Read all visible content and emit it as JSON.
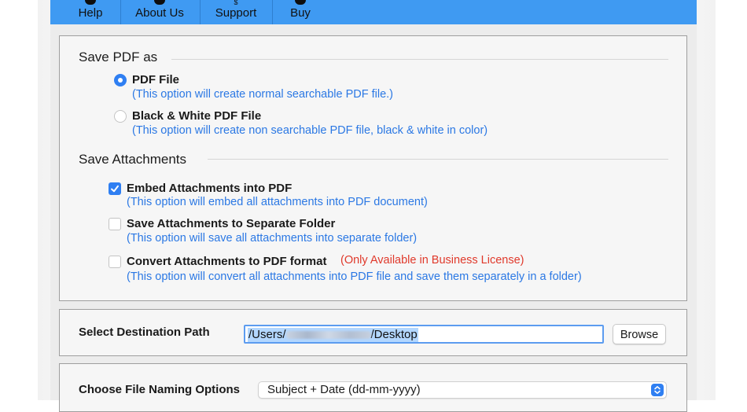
{
  "toolbar": {
    "buttons": [
      {
        "label": "Help",
        "icon": "help-icon"
      },
      {
        "label": "About Us",
        "icon": "info-icon"
      },
      {
        "label": "Support",
        "icon": "dollar-support-icon"
      },
      {
        "label": "Buy",
        "icon": "cart-icon"
      }
    ]
  },
  "save_pdf": {
    "title": "Save PDF as",
    "options": [
      {
        "label": "PDF File",
        "desc": "(This option will create normal searchable PDF file.)",
        "selected": true
      },
      {
        "label": "Black & White PDF File",
        "desc": "(This option will create non searchable PDF file, black & white in color)",
        "selected": false
      }
    ]
  },
  "attachments": {
    "title": "Save Attachments",
    "options": [
      {
        "label": "Embed Attachments into PDF",
        "desc": "(This option will embed all attachments into PDF document)",
        "checked": true
      },
      {
        "label": "Save Attachments to Separate Folder",
        "desc": "(This option will save all attachments into separate folder)",
        "checked": false
      },
      {
        "label": "Convert Attachments to PDF format",
        "warning": "(Only Available in Business License)",
        "desc": "(This option will convert all attachments into PDF file and save them separately in a folder)",
        "checked": false
      }
    ]
  },
  "destination": {
    "label": "Select Destination Path",
    "path_prefix": "/Users/",
    "path_suffix": "/Desktop",
    "browse_label": "Browse"
  },
  "naming": {
    "label": "Choose File Naming Options",
    "selected": "Subject + Date (dd-mm-yyyy)"
  },
  "colors": {
    "toolbar": "#3f9af2",
    "accent": "#2f7ff2",
    "desc_text": "#2b78e4",
    "warning_text": "#e0392b"
  }
}
